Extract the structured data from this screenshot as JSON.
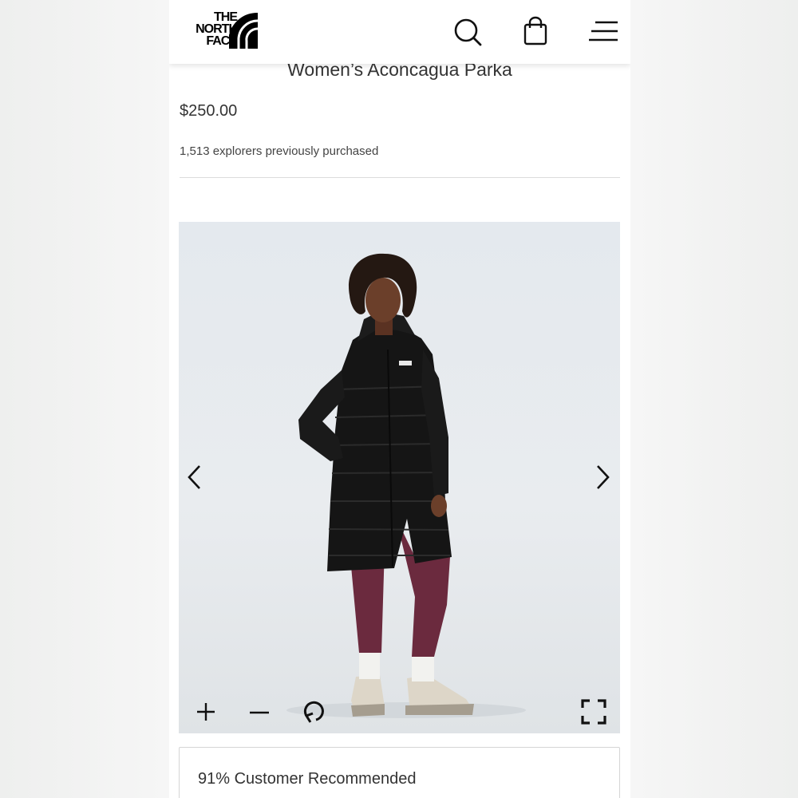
{
  "brand": {
    "logo_line1": "THE",
    "logo_line2": "NORTH",
    "logo_line3": "FACE"
  },
  "header": {
    "icons": [
      "search-icon",
      "shopping-bag-icon",
      "hamburger-menu-icon"
    ]
  },
  "product": {
    "title": "Women’s Aconcagua Parka",
    "price": "$250.00",
    "purchased": "1,513 explorers previously purchased"
  },
  "gallery": {
    "controls": [
      "chevron-left-icon",
      "chevron-right-icon",
      "plus-icon",
      "minus-icon",
      "rotate-icon",
      "fullscreen-icon"
    ],
    "background_color": "#e6eaee"
  },
  "recommendation": {
    "text": "91% Customer Recommended"
  },
  "colors": {
    "text": "#333333",
    "divider": "#dcdcdc",
    "parka": "#151515",
    "leggings": "#6b2a3e"
  }
}
